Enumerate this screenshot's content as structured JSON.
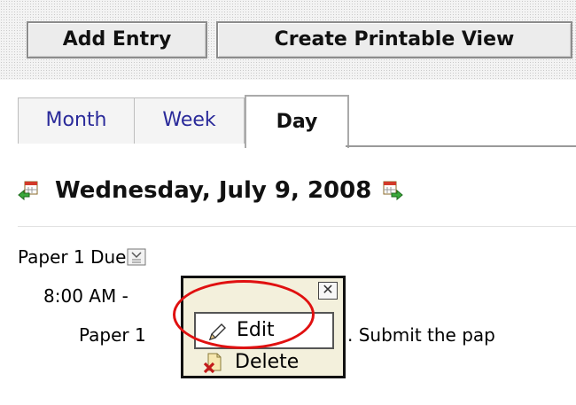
{
  "toolbar": {
    "add_entry": "Add Entry",
    "printable_view": "Create Printable View"
  },
  "tabs": [
    {
      "label": "Month",
      "selected": false
    },
    {
      "label": "Week",
      "selected": false
    },
    {
      "label": "Day",
      "selected": true
    }
  ],
  "day_header": {
    "date": "Wednesday, July 9, 2008",
    "prev_icon": "previous-day-icon",
    "next_icon": "next-day-icon"
  },
  "entry": {
    "title": "Paper 1 Due",
    "time": "8:00 AM -",
    "description_start": "Paper 1",
    "description_end": ". Submit the pap"
  },
  "context_menu": {
    "close": "✕",
    "items": [
      {
        "label": "Edit",
        "icon": "pencil-icon",
        "highlighted": true
      },
      {
        "label": "Delete",
        "icon": "delete-icon",
        "highlighted": false
      }
    ]
  },
  "colors": {
    "tab_link": "#2a2a9a",
    "highlight_oval": "#e01010",
    "menu_background": "#f3f0dc"
  }
}
